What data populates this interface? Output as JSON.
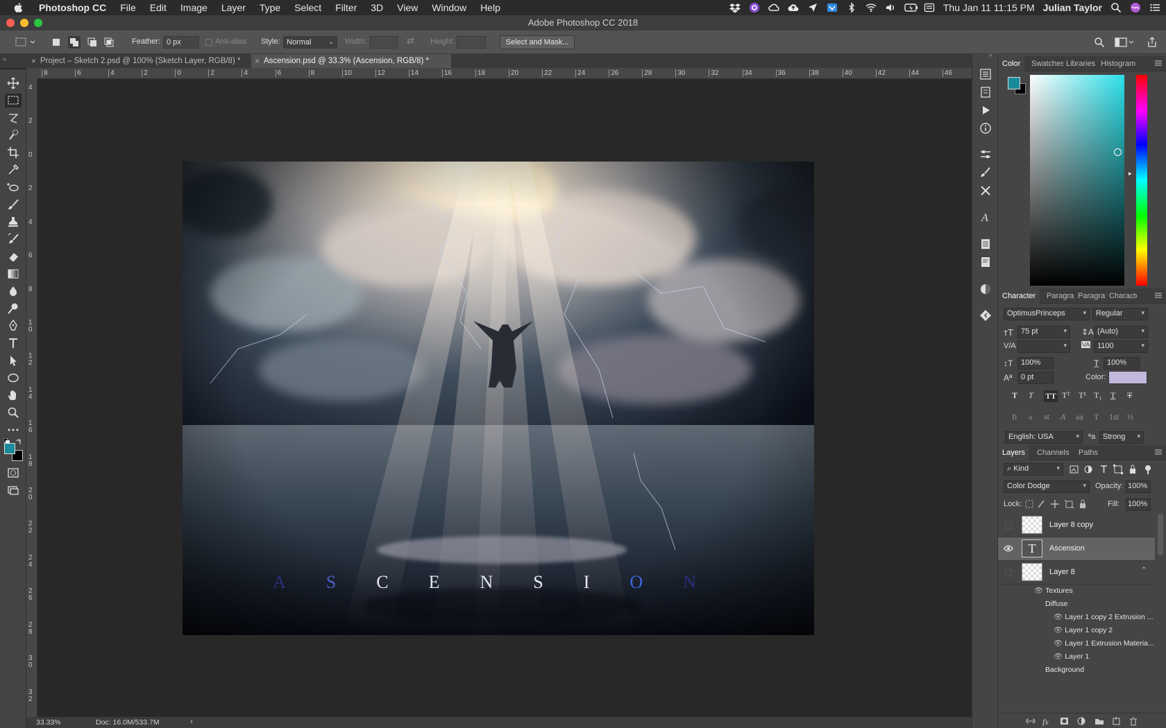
{
  "menubar": {
    "items": [
      "Photoshop CC",
      "File",
      "Edit",
      "Image",
      "Layer",
      "Type",
      "Select",
      "Filter",
      "3D",
      "View",
      "Window",
      "Help"
    ],
    "datetime": "Thu Jan 11  11:15 PM",
    "user": "Julian Taylor"
  },
  "window": {
    "title": "Adobe Photoshop CC 2018"
  },
  "options": {
    "feather_label": "Feather:",
    "feather_value": "0 px",
    "antialias_label": "Anti-alias",
    "style_label": "Style:",
    "style_value": "Normal",
    "width_label": "Width:",
    "height_label": "Height:",
    "select_mask_label": "Select and Mask..."
  },
  "tabs": [
    {
      "label": "Project – Sketch 2.psd @ 100% (Sketch Layer, RGB/8) *",
      "active": false
    },
    {
      "label": "Ascension.psd @ 33.3% (Ascension, RGB/8) *",
      "active": true
    }
  ],
  "rulers": {
    "top": [
      "8",
      "6",
      "4",
      "2",
      "0",
      "2",
      "4",
      "6",
      "8",
      "10",
      "12",
      "14",
      "16",
      "18",
      "20",
      "22",
      "24",
      "26",
      "28",
      "30",
      "32",
      "34",
      "36",
      "38",
      "40",
      "42",
      "44",
      "46"
    ],
    "left": [
      "4",
      "2",
      "0",
      "2",
      "4",
      "6",
      "8",
      "1 0",
      "1 2",
      "1 4",
      "1 6",
      "1 8",
      "2 0",
      "2 2",
      "2 4",
      "2 6",
      "2 8",
      "3 0",
      "3 2"
    ]
  },
  "artwork": {
    "title_letters": [
      "A",
      "S",
      "C",
      "E",
      "N",
      "S",
      "I",
      "O",
      "N"
    ]
  },
  "status": {
    "zoom": "33.33%",
    "doc": "Doc: 16.0M/533.7M"
  },
  "colors": {
    "foreground": "#1a8b9a",
    "background": "#000000",
    "hue_selected": "#2de0ea",
    "text_color": "#c2b8dc"
  },
  "color_panel": {
    "tabs": [
      "Color",
      "Swatches",
      "Libraries",
      "Histogram"
    ]
  },
  "character_panel": {
    "tabs": [
      "Character",
      "Paragraph",
      "Paragraph",
      "Character"
    ],
    "font_family": "OptimusPrinceps",
    "font_style": "Regular",
    "font_size": "75 pt",
    "leading": "(Auto)",
    "kerning": "",
    "tracking": "1100",
    "vertical_scale": "100%",
    "horizontal_scale": "100%",
    "baseline_shift": "0 pt",
    "color_label": "Color:",
    "style_buttons": [
      "T",
      "T",
      "TT",
      "Tᵀ",
      "T¹",
      "T₁",
      "T",
      "T"
    ],
    "opentype_buttons": [
      "fi",
      "ℴ",
      "st",
      "A",
      "aa",
      "T",
      "1st",
      "½"
    ],
    "language": "English: USA",
    "antialias_symbol": "ªa",
    "antialias": "Strong"
  },
  "layers_panel": {
    "tabs": [
      "Layers",
      "Channels",
      "Paths"
    ],
    "filter_kind": "Kind",
    "blend_mode": "Color Dodge",
    "opacity_label": "Opacity:",
    "opacity": "100%",
    "lock_label": "Lock:",
    "fill_label": "Fill:",
    "fill": "100%",
    "layers": [
      {
        "name": "Layer 8 copy",
        "visible": false,
        "selected": false
      },
      {
        "name": "Ascension",
        "visible": true,
        "selected": true
      },
      {
        "name": "Layer 8",
        "visible": false,
        "selected": false
      }
    ],
    "textures_label": "Textures",
    "diffuse_label": "Diffuse",
    "sublayers": [
      "Layer 1 copy 2 Extrusion ...",
      "Layer 1 copy 2",
      "Layer 1 Extrusion Materia...",
      "Layer 1"
    ],
    "background_label": "Background"
  }
}
